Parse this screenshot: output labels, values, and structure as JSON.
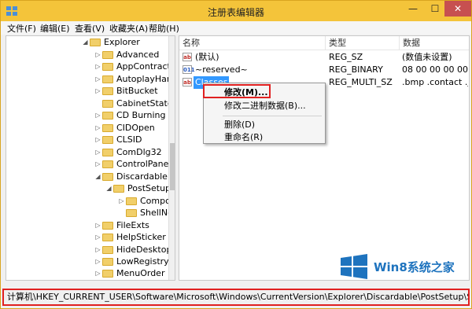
{
  "window": {
    "title": "注册表编辑器"
  },
  "controls": {
    "minimize": "—",
    "maximize": "☐",
    "close": "✕"
  },
  "menu": [
    "文件(F)",
    "编辑(E)",
    "查看(V)",
    "收藏夹(A)",
    "帮助(H)"
  ],
  "tree": [
    {
      "label": "Explorer",
      "expander": "◢",
      "level": 0
    },
    {
      "label": "Advanced",
      "expander": "▷",
      "level": 1
    },
    {
      "label": "AppContract",
      "expander": "▷",
      "level": 1
    },
    {
      "label": "AutoplayHanc",
      "expander": "▷",
      "level": 1
    },
    {
      "label": "BitBucket",
      "expander": "▷",
      "level": 1
    },
    {
      "label": "CabinetState",
      "expander": "",
      "level": 1
    },
    {
      "label": "CD Burning",
      "expander": "▷",
      "level": 1
    },
    {
      "label": "CIDOpen",
      "expander": "▷",
      "level": 1
    },
    {
      "label": "CLSID",
      "expander": "▷",
      "level": 1
    },
    {
      "label": "ComDlg32",
      "expander": "▷",
      "level": 1
    },
    {
      "label": "ControlPanel",
      "expander": "▷",
      "level": 1
    },
    {
      "label": "Discardable",
      "expander": "◢",
      "level": 1
    },
    {
      "label": "PostSetup",
      "expander": "◢",
      "level": 2
    },
    {
      "label": "Compo",
      "expander": "▷",
      "level": 3
    },
    {
      "label": "ShellNe",
      "expander": "",
      "level": 3
    },
    {
      "label": "FileExts",
      "expander": "▷",
      "level": 1
    },
    {
      "label": "HelpSticker",
      "expander": "▷",
      "level": 1
    },
    {
      "label": "HideDesktopl",
      "expander": "▷",
      "level": 1
    },
    {
      "label": "LowRegistry",
      "expander": "▷",
      "level": 1
    },
    {
      "label": "MenuOrder",
      "expander": "▷",
      "level": 1
    }
  ],
  "columns": {
    "name": "名称",
    "type": "类型",
    "data": "数据"
  },
  "values": [
    {
      "icon": "ab",
      "name": "(默认)",
      "type": "REG_SZ",
      "data": "(数值未设置)"
    },
    {
      "icon": "011",
      "name": "~reserved~",
      "type": "REG_BINARY",
      "data": "08 00 00 00 00 00"
    },
    {
      "icon": "ab",
      "name": "Classes",
      "type": "REG_MULTI_SZ",
      "data": ".bmp .contact .jnt"
    }
  ],
  "context_menu": {
    "modify": "修改(M)...",
    "modify_binary": "修改二进制数据(B)...",
    "delete": "删除(D)",
    "rename": "重命名(R)"
  },
  "status": {
    "path": "计算机\\HKEY_CURRENT_USER\\Software\\Microsoft\\Windows\\CurrentVersion\\Explorer\\Discardable\\PostSetup\\ShellNew"
  },
  "watermark": {
    "text": "Win8系统之家"
  },
  "colors": {
    "titlebar": "#f4c43a",
    "selection": "#3399ff",
    "annotation": "#e02020",
    "watermark": "#1e73be"
  }
}
